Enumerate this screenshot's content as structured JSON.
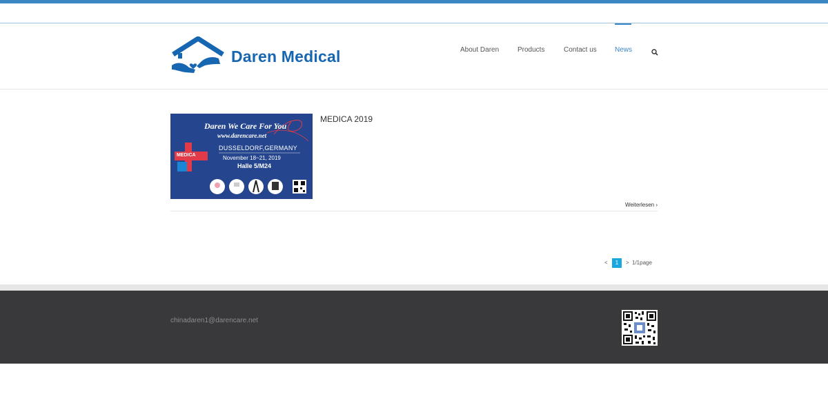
{
  "brand": {
    "name": "Daren Medical",
    "color": "#1766b2"
  },
  "nav": {
    "items": [
      {
        "label": "About Daren",
        "active": false
      },
      {
        "label": "Products",
        "active": false
      },
      {
        "label": "Contact us",
        "active": false
      },
      {
        "label": "News",
        "active": true
      }
    ],
    "search_icon": "search-icon",
    "active_color": "#3b86c4"
  },
  "posts": [
    {
      "title": "MEDICA 2019",
      "read_more": "Weiterlesen",
      "thumbnail": {
        "headline": "Daren We Care For You",
        "website": "www.darencare.net",
        "badge": "MEDICA",
        "location": "DUSSELDORF,GERMANY",
        "dates": "November 18~21, 2019",
        "booth": "Halle 5/M24"
      }
    }
  ],
  "pagination": {
    "prev": "<",
    "current": "1",
    "next": ">",
    "info": "1/1page",
    "current_color": "#1aa7e0"
  },
  "footer": {
    "email": "chinadaren1@darencare.net",
    "background": "#39393b"
  }
}
